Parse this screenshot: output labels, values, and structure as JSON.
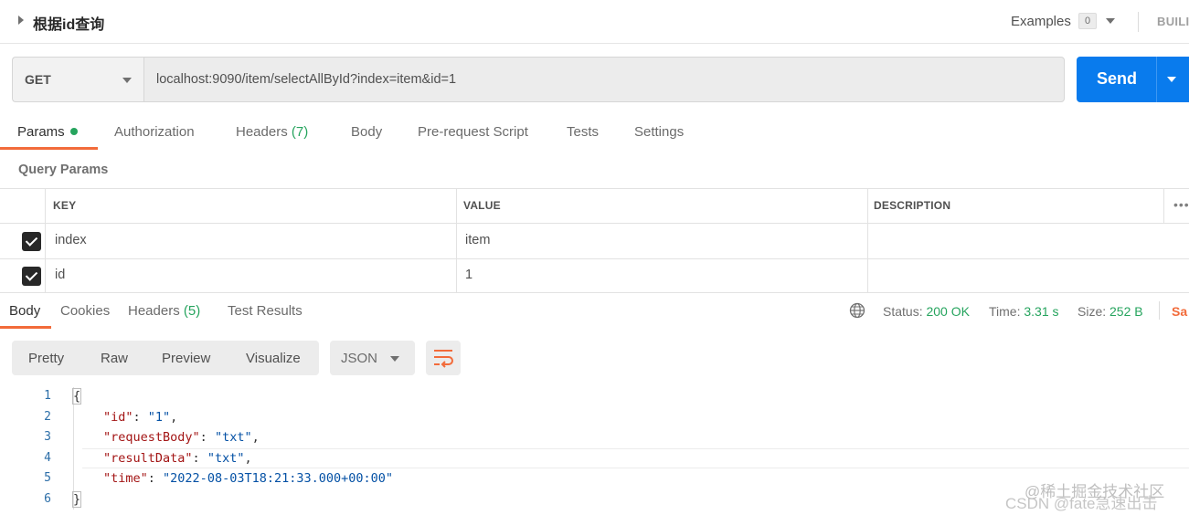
{
  "request": {
    "name": "根据id查询",
    "examples_label": "Examples",
    "examples_count": "0",
    "build_label": "BUILI",
    "method": "GET",
    "url": "localhost:9090/item/selectAllById?index=item&id=1",
    "send_label": "Send"
  },
  "request_tabs": [
    {
      "label": "Params"
    },
    {
      "label": "Authorization"
    },
    {
      "label": "Headers",
      "count": "(7)"
    },
    {
      "label": "Body"
    },
    {
      "label": "Pre-request Script"
    },
    {
      "label": "Tests"
    },
    {
      "label": "Settings"
    }
  ],
  "query_params": {
    "title": "Query Params",
    "columns": [
      "KEY",
      "VALUE",
      "DESCRIPTION"
    ],
    "more": "•••",
    "rows": [
      {
        "checked": true,
        "key": "index",
        "value": "item",
        "description": ""
      },
      {
        "checked": true,
        "key": "id",
        "value": "1",
        "description": ""
      }
    ]
  },
  "response": {
    "tabs": [
      {
        "label": "Body"
      },
      {
        "label": "Cookies"
      },
      {
        "label": "Headers",
        "count": "(5)"
      },
      {
        "label": "Test Results"
      }
    ],
    "status_label": "Status:",
    "status_value": "200 OK",
    "time_label": "Time:",
    "time_value": "3.31 s",
    "size_label": "Size:",
    "size_value": "252 B",
    "save_label": "Sa",
    "view_modes": [
      "Pretty",
      "Raw",
      "Preview",
      "Visualize"
    ],
    "format": "JSON"
  },
  "code": {
    "line_numbers": [
      "1",
      "2",
      "3",
      "4",
      "5",
      "6"
    ],
    "open": "{",
    "close": "}",
    "fields": [
      {
        "key": "\"id\"",
        "value": "\"1\"",
        "comma": ","
      },
      {
        "key": "\"requestBody\"",
        "value": "\"txt\"",
        "comma": ","
      },
      {
        "key": "\"resultData\"",
        "value": "\"txt\"",
        "comma": ","
      },
      {
        "key": "\"time\"",
        "value": "\"2022-08-03T18:21:33.000+00:00\"",
        "comma": ""
      }
    ]
  },
  "watermark": {
    "line1": "@稀土掘金技术社区",
    "line2": "CSDN @fate急速出击"
  },
  "colors": {
    "accent": "#f26b3a",
    "send": "#097bed",
    "success": "#26a45e"
  }
}
